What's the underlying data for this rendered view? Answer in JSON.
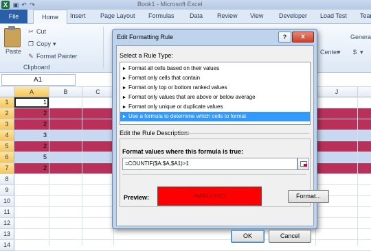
{
  "quick_access": {
    "logo": "X",
    "save_icon": "save-icon",
    "undo_icon": "undo-icon",
    "redo_icon": "redo-icon",
    "window_title": "Book1 - Microsoft Excel"
  },
  "ribbon_tabs": [
    "File",
    "Home",
    "Insert",
    "Page Layout",
    "Formulas",
    "Data",
    "Review",
    "View",
    "Developer",
    "Load Test",
    "Team"
  ],
  "ribbon": {
    "paste": "Paste",
    "cut": "Cut",
    "copy": "Copy",
    "copy_arrow": "▾",
    "format_painter": "Format Painter",
    "clipboard_group": "Clipboard",
    "center": "Center",
    "center_arrow": "▾",
    "general": "Genera",
    "currency": "$",
    "currency_arrow": "▾"
  },
  "name_box": {
    "value": "A1"
  },
  "grid": {
    "columns": [
      "A",
      "B",
      "C",
      "J"
    ],
    "rows": [
      {
        "num": "1",
        "value": "1",
        "highlight": false
      },
      {
        "num": "2",
        "value": "2",
        "highlight": true
      },
      {
        "num": "3",
        "value": "2",
        "highlight": true
      },
      {
        "num": "4",
        "value": "3",
        "highlight": false
      },
      {
        "num": "5",
        "value": "2",
        "highlight": true
      },
      {
        "num": "6",
        "value": "5",
        "highlight": false
      },
      {
        "num": "7",
        "value": "2",
        "highlight": true
      },
      {
        "num": "8",
        "value": "",
        "highlight": false
      },
      {
        "num": "9",
        "value": "",
        "highlight": false
      },
      {
        "num": "10",
        "value": "",
        "highlight": false
      },
      {
        "num": "11",
        "value": "",
        "highlight": false
      },
      {
        "num": "12",
        "value": "",
        "highlight": false
      },
      {
        "num": "13",
        "value": "",
        "highlight": false
      },
      {
        "num": "14",
        "value": "",
        "highlight": false
      }
    ],
    "highlight_color": "#b8315b",
    "plain_row_color": "#ffffff",
    "alt_row_color": "#c6d9f1"
  },
  "dialog": {
    "title": "Edit Formatting Rule",
    "help": "?",
    "close": "x",
    "rule_type_label": "Select a Rule Type:",
    "rule_types": [
      "Format all cells based on their values",
      "Format only cells that contain",
      "Format only top or bottom ranked values",
      "Format only values that are above or below average",
      "Format only unique or duplicate values",
      "Use a formula to determine which cells to format"
    ],
    "selected_rule_index": 5,
    "description_label": "Edit the Rule Description:",
    "formula_label": "Format values where this formula is true:",
    "formula": "=COUNTIF($A:$A,$A1)>1",
    "preview_label": "Preview:",
    "preview_text": "AaBbCcYyZz",
    "preview_color": "#ff0000",
    "format_button": "Format...",
    "ok_button": "OK",
    "cancel_button": "Cancel"
  }
}
